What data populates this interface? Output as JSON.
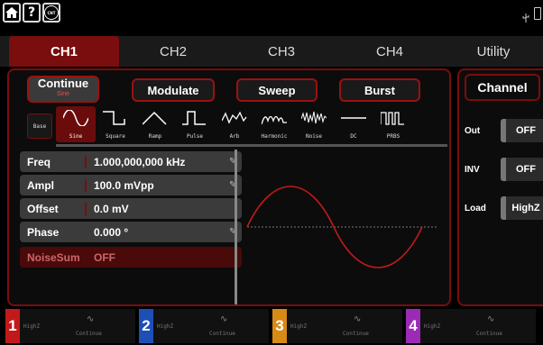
{
  "topbar": {
    "home_icon": "home-icon",
    "help_label": "?",
    "cnt_label": "CNT",
    "usb_icon": "usb-icon",
    "battery_icon": "battery-icon"
  },
  "tabs": [
    "CH1",
    "CH2",
    "CH3",
    "CH4",
    "Utility"
  ],
  "modes": {
    "continue_label": "Continue",
    "continue_sub": "Sine",
    "modulate_label": "Modulate",
    "sweep_label": "Sweep",
    "burst_label": "Burst"
  },
  "waveforms": {
    "base": "Base",
    "sine": "Sine",
    "square": "Square",
    "ramp": "Ramp",
    "pulse": "Pulse",
    "arb": "Arb",
    "harmonic": "Harmonic",
    "noise": "Noise",
    "dc": "DC",
    "prbs": "PRBS"
  },
  "params": {
    "freq_name": "Freq",
    "freq_value": "1.000,000,000 kHz",
    "ampl_name": "Ampl",
    "ampl_value": "100.0 mVpp",
    "offset_name": "Offset",
    "offset_value": "0.0 mV",
    "phase_name": "Phase",
    "phase_value": "0.000 °",
    "noisesum_name": "NoiseSum",
    "noisesum_value": "OFF"
  },
  "channel_panel": {
    "title": "Channel",
    "out_label": "Out",
    "out_value": "OFF",
    "inv_label": "INV",
    "inv_value": "OFF",
    "load_label": "Load",
    "load_value": "HighZ"
  },
  "status": {
    "ch1_num": "1",
    "ch1_load": "HighZ",
    "ch1_mode": "Continue",
    "ch2_num": "2",
    "ch2_load": "HighZ",
    "ch2_mode": "Continue",
    "ch3_num": "3",
    "ch3_load": "HighZ",
    "ch3_mode": "Continue",
    "ch4_num": "4",
    "ch4_load": "HighZ",
    "ch4_mode": "Continue"
  },
  "colors": {
    "accent": "#7a0d0d",
    "wave": "#c21a1a",
    "ch1": "#c21a1a",
    "ch2": "#1e4fb4",
    "ch3": "#d88a16",
    "ch4": "#9b2bb5"
  }
}
